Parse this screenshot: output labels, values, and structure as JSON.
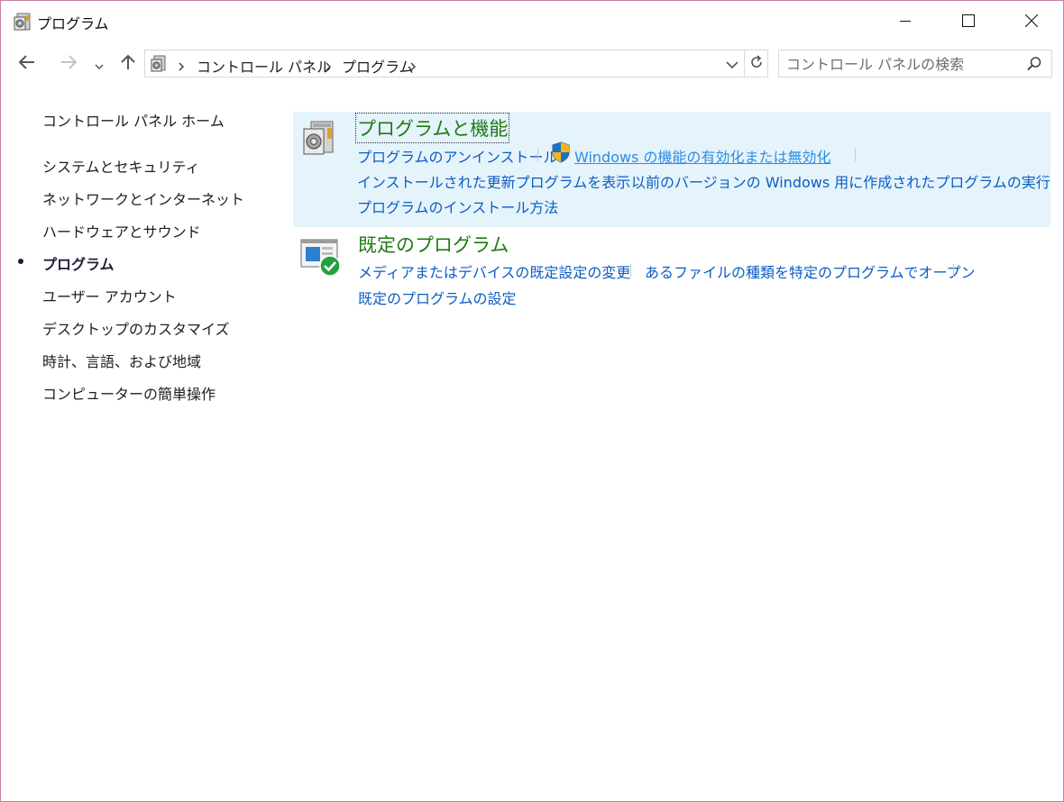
{
  "window": {
    "title": "プログラム"
  },
  "address": {
    "breadcrumbs": [
      "コントロール パネル",
      "プログラム"
    ]
  },
  "search": {
    "placeholder": "コントロール パネルの検索"
  },
  "sidebar": {
    "home": "コントロール パネル ホーム",
    "items": [
      {
        "label": "システムとセキュリティ",
        "current": false
      },
      {
        "label": "ネットワークとインターネット",
        "current": false
      },
      {
        "label": "ハードウェアとサウンド",
        "current": false
      },
      {
        "label": "プログラム",
        "current": true
      },
      {
        "label": "ユーザー アカウント",
        "current": false
      },
      {
        "label": "デスクトップのカスタマイズ",
        "current": false
      },
      {
        "label": "時計、言語、および地域",
        "current": false
      },
      {
        "label": "コンピューターの簡単操作",
        "current": false
      }
    ]
  },
  "categories": [
    {
      "title": "プログラムと機能",
      "icon": "programs-features-icon",
      "links": [
        "プログラムのアンインストール",
        "Windows の機能の有効化または無効化",
        "インストールされた更新プログラムを表示",
        "以前のバージョンの Windows 用に作成されたプログラムの実行",
        "プログラムのインストール方法"
      ]
    },
    {
      "title": "既定のプログラム",
      "icon": "default-programs-icon",
      "links": [
        "メディアまたはデバイスの既定設定の変更",
        "あるファイルの種類を特定のプログラムでオープン",
        "既定のプログラムの設定"
      ]
    }
  ],
  "colors": {
    "link": "#0b5ec4",
    "category_title": "#1e7a12",
    "highlight_bg": "#e5f3fb",
    "window_border": "#c67ea8"
  }
}
